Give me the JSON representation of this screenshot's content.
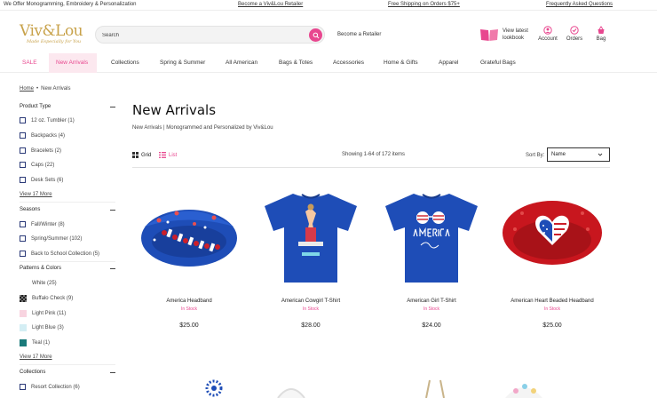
{
  "topbar": {
    "message": "We Offer Monogramming, Embroidery & Personalization",
    "links": [
      "Become a Viv&Lou Retailer",
      "Free Shipping on Orders $75+",
      "Frequently Asked Questions"
    ]
  },
  "header": {
    "logo_text": "Viv&Lou",
    "logo_tagline": "Made Especially for You",
    "search_placeholder": "Search",
    "retailer_link": "Become a Retailer",
    "lookbook_line1": "View latest",
    "lookbook_line2": "lookbook",
    "account_label": "Account",
    "orders_label": "Orders",
    "bag_label": "Bag"
  },
  "nav": {
    "items": [
      "SALE",
      "New Arrivals",
      "Collections",
      "Spring & Summer",
      "All American",
      "Bags & Totes",
      "Accessories",
      "Home & Gifts",
      "Apparel",
      "Grateful Bags"
    ]
  },
  "breadcrumb": {
    "home": "Home",
    "separator": "•",
    "current": "New Arrivals"
  },
  "sidebar": {
    "product_type": {
      "heading": "Product Type",
      "items": [
        "12 oz. Tumbler (1)",
        "Backpacks (4)",
        "Bracelets (2)",
        "Caps (22)",
        "Desk Sets (6)"
      ],
      "more": "View 17 More"
    },
    "seasons": {
      "heading": "Seasons",
      "items": [
        "Fall/Winter (8)",
        "Spring/Summer (102)",
        "Back to School Collection (5)"
      ]
    },
    "patterns": {
      "heading": "Patterns & Colors",
      "items": [
        {
          "label": "White (25)",
          "color": "#ffffff"
        },
        {
          "label": "Buffalo Check (9)",
          "color": "#222222"
        },
        {
          "label": "Light Pink (11)",
          "color": "#f8d4e0"
        },
        {
          "label": "Light Blue (3)",
          "color": "#d4eef4"
        },
        {
          "label": "Teal (1)",
          "color": "#1a7a7a"
        }
      ],
      "more": "View 17 More"
    },
    "collections": {
      "heading": "Collections",
      "items": [
        "Resort Collection (6)"
      ]
    }
  },
  "main": {
    "title": "New Arrivals",
    "subtitle": "New Arrivals | Monogrammed and Personalized by Viv&Lou",
    "grid_label": "Grid",
    "list_label": "List",
    "showing": "Showing 1-64 of 172 items",
    "sort_label": "Sort By:",
    "sort_value": "Name"
  },
  "products": [
    {
      "name": "America Headband",
      "stock": "In Stock",
      "price": "$25.00"
    },
    {
      "name": "American Cowgirl T-Shirt",
      "stock": "In Stock",
      "price": "$28.00"
    },
    {
      "name": "American Girl T-Shirt",
      "stock": "In Stock",
      "price": "$24.00"
    },
    {
      "name": "American Heart Beaded Headband",
      "stock": "In Stock",
      "price": "$25.00"
    }
  ],
  "colors": {
    "accent_pink": "#e8478f",
    "brand_gold": "#c8a24a",
    "royal_blue": "#1e4db7",
    "red": "#cc1f2a"
  }
}
